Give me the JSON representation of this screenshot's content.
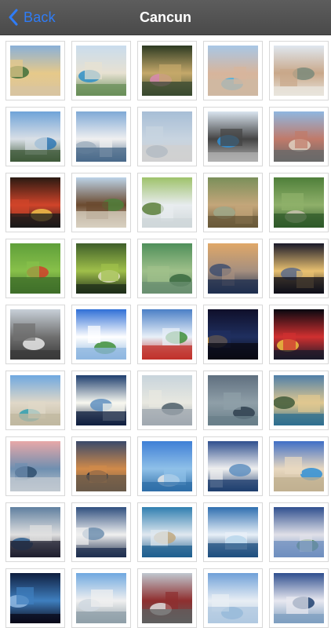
{
  "navbar": {
    "back_label": "Back",
    "title": "Cancun"
  },
  "photos": [
    {
      "name": "hotel-building-photo",
      "colors": [
        "#8ab0d8",
        "#e6c98a",
        "#3f6f3a",
        "#d8c4a0"
      ]
    },
    {
      "name": "resort-pool-photo",
      "colors": [
        "#c9dced",
        "#e7e1d2",
        "#2f8fc7",
        "#6a8f5a"
      ]
    },
    {
      "name": "hammock-photo",
      "colors": [
        "#2c3a22",
        "#c4a86a",
        "#d88ab0",
        "#3a4a30"
      ]
    },
    {
      "name": "hotel-pool-photo",
      "colors": [
        "#a8c7e6",
        "#d7b59c",
        "#4ab0e0",
        "#cfb8a2"
      ]
    },
    {
      "name": "hotel-tower-photo",
      "colors": [
        "#dfe7ef",
        "#c9a88a",
        "#7a8a7a",
        "#e8e4dc"
      ]
    },
    {
      "name": "lagoon-city-photo",
      "colors": [
        "#6fa3d8",
        "#d9dfe6",
        "#2f78b4",
        "#3f5a3a"
      ]
    },
    {
      "name": "skyscrapers-photo",
      "colors": [
        "#7fa9d6",
        "#f0f0f0",
        "#a0b0c0",
        "#4a6a8a"
      ]
    },
    {
      "name": "infinity-pool-photo",
      "colors": [
        "#a7bed6",
        "#c8d4e0",
        "#5f7f9f",
        "#d0d0d0"
      ]
    },
    {
      "name": "dancer-statue-photo",
      "colors": [
        "#d9e4ef",
        "#444444",
        "#2f8fd6",
        "#b0b0b0"
      ]
    },
    {
      "name": "shopping-center-photo",
      "colors": [
        "#8fb7e0",
        "#c07a6a",
        "#e0d0c0",
        "#6a6a6a"
      ]
    },
    {
      "name": "festival-arch-photo",
      "colors": [
        "#2a1a12",
        "#d0442a",
        "#f0c04a",
        "#1a1a1a"
      ]
    },
    {
      "name": "thatched-hut-photo",
      "colors": [
        "#bcd3e8",
        "#6b4a2f",
        "#4f7f3a",
        "#d8d0c0"
      ]
    },
    {
      "name": "picnic-area-photo",
      "colors": [
        "#9ec26a",
        "#e8ecef",
        "#5a7f3a",
        "#cfd7d9"
      ]
    },
    {
      "name": "palapa-hut-photo",
      "colors": [
        "#7a8f5a",
        "#c4a67a",
        "#9fa88a",
        "#6a5a3a"
      ]
    },
    {
      "name": "jungle-path-photo",
      "colors": [
        "#4f7f3a",
        "#8fb06a",
        "#c9c3b0",
        "#2f5a2a"
      ]
    },
    {
      "name": "red-flower-photo",
      "colors": [
        "#5f9f3a",
        "#88c04a",
        "#d0402a",
        "#3f6f2a"
      ]
    },
    {
      "name": "cenote-photo",
      "colors": [
        "#3f5f2a",
        "#a0c04a",
        "#e0e0c0",
        "#1f2f1a"
      ]
    },
    {
      "name": "palm-leaves-photo",
      "colors": [
        "#4f8f5a",
        "#9fc08a",
        "#3a6a40",
        "#6a8f70"
      ]
    },
    {
      "name": "beach-sunset-photo",
      "colors": [
        "#e0a868",
        "#a58f7f",
        "#3f4f6f",
        "#1f2f4f"
      ]
    },
    {
      "name": "fisheye-sunset-photo",
      "colors": [
        "#1a1a2a",
        "#e8c070",
        "#5a6a8a",
        "#0f0f1a"
      ]
    },
    {
      "name": "fisheye-sand-photo",
      "colors": [
        "#c8d0d8",
        "#6f6f6f",
        "#e8e8e8",
        "#3a3a3a"
      ]
    },
    {
      "name": "fisheye-flag-photo",
      "colors": [
        "#2f6fd6",
        "#ffffff",
        "#3f8f3a",
        "#8fb7e0"
      ]
    },
    {
      "name": "mexican-flag-photo",
      "colors": [
        "#4a7fc6",
        "#e8f0f8",
        "#3f8f3a",
        "#c0302a"
      ]
    },
    {
      "name": "night-city-photo",
      "colors": [
        "#0f0f2a",
        "#1f2f5f",
        "#e0a030",
        "#0a0a14"
      ]
    },
    {
      "name": "christmas-tree-night-photo",
      "colors": [
        "#080810",
        "#d03030",
        "#f0c040",
        "#1a1a2a"
      ]
    },
    {
      "name": "beach-hotels-photo",
      "colors": [
        "#6fa8e0",
        "#e0d8c8",
        "#2f9fb0",
        "#c0b8a0"
      ]
    },
    {
      "name": "sun-over-sea-photo",
      "colors": [
        "#1f3f6f",
        "#f8f8f0",
        "#5f8fbf",
        "#0f1f3f"
      ]
    },
    {
      "name": "misty-beach-photo",
      "colors": [
        "#c8d4dc",
        "#e8e8e0",
        "#4f5f6a",
        "#a0a8b0"
      ]
    },
    {
      "name": "cloudy-sea-photo",
      "colors": [
        "#5f6f7f",
        "#8f9fa8",
        "#2f3f4f",
        "#6a7f8a"
      ]
    },
    {
      "name": "rocky-coast-photo",
      "colors": [
        "#4f7fa8",
        "#e0c890",
        "#3f5a3a",
        "#2f6f8f"
      ]
    },
    {
      "name": "pink-sky-sea-photo",
      "colors": [
        "#e8a8a8",
        "#6f8fb0",
        "#2f4f6f",
        "#c0c8d0"
      ]
    },
    {
      "name": "dusk-sea-photo",
      "colors": [
        "#3a4a6a",
        "#d08a4a",
        "#1f2a3f",
        "#6a5a4a"
      ]
    },
    {
      "name": "turquoise-waves-photo",
      "colors": [
        "#3f7fd6",
        "#8fc0e8",
        "#e8e8e8",
        "#2f6fa8"
      ]
    },
    {
      "name": "stormy-sky-photo",
      "colors": [
        "#2f4f8f",
        "#f0f0f0",
        "#5f8fbf",
        "#1f3f6f"
      ]
    },
    {
      "name": "hotel-shore-photo",
      "colors": [
        "#3f6fc6",
        "#e8d8c0",
        "#2f8fd6",
        "#c0b090"
      ]
    },
    {
      "name": "swimmers-sea-photo",
      "colors": [
        "#5f7f9f",
        "#e0e0e0",
        "#2f5f8f",
        "#1f1f2f"
      ]
    },
    {
      "name": "cloud-bank-photo",
      "colors": [
        "#2f4f7f",
        "#f0f0f0",
        "#6f8faf",
        "#1f2f4f"
      ]
    },
    {
      "name": "waves-sand-photo",
      "colors": [
        "#2f7fb0",
        "#e0e8f0",
        "#c0a880",
        "#1f5f8f"
      ]
    },
    {
      "name": "blue-surf-photo",
      "colors": [
        "#2f6fb0",
        "#e8f0f8",
        "#4f9fd0",
        "#1f4f7f"
      ]
    },
    {
      "name": "green-coast-photo",
      "colors": [
        "#2f4f8f",
        "#e0e0e8",
        "#3f7f3a",
        "#6f8fbf"
      ]
    },
    {
      "name": "underwater-photo",
      "colors": [
        "#0f1f3f",
        "#3f7fbf",
        "#8fb7e0",
        "#0a0a1a"
      ]
    },
    {
      "name": "white-hotel-photo",
      "colors": [
        "#6fa8e0",
        "#f0f0f0",
        "#d0d8e0",
        "#8f9fa8"
      ]
    },
    {
      "name": "restaurant-sign-photo",
      "colors": [
        "#c0c8d0",
        "#8f2f2f",
        "#e0e0e0",
        "#5f5f5f"
      ]
    },
    {
      "name": "sky-clouds-photo",
      "colors": [
        "#6fa0d8",
        "#e8eef4",
        "#4f8fc6",
        "#b0c8e0"
      ]
    },
    {
      "name": "dark-clouds-photo",
      "colors": [
        "#2f4f8f",
        "#e8e8f0",
        "#1f3f6f",
        "#7f9fc0"
      ]
    }
  ]
}
